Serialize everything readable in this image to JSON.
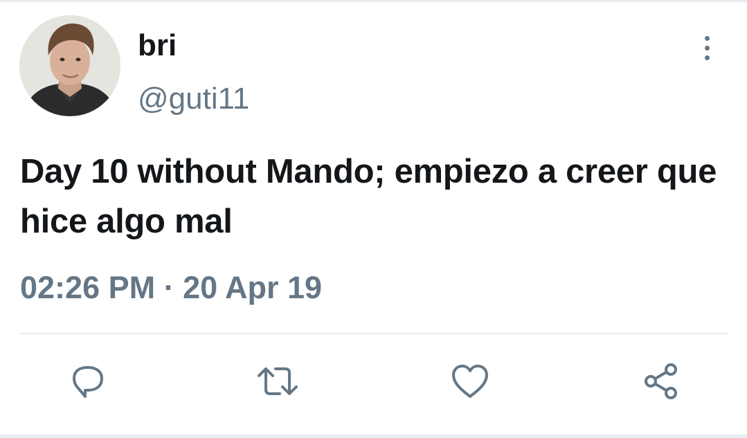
{
  "tweet": {
    "author": {
      "display_name": "bri",
      "handle": "@guti11"
    },
    "text": "Day 10 without Mando; empiezo a creer que hice algo mal",
    "time": "02:26 PM",
    "separator": "·",
    "date": "20 Apr 19"
  },
  "icons": {
    "more": "more-vertical-icon",
    "reply": "reply-icon",
    "retweet": "retweet-icon",
    "like": "heart-icon",
    "share": "share-icon"
  },
  "colors": {
    "text_primary": "#14171a",
    "text_secondary": "#657786",
    "divider": "#e6ecf0"
  }
}
